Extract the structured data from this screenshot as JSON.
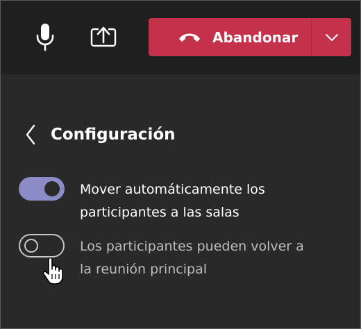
{
  "toolbar": {
    "mic_icon": "microphone-icon",
    "share_icon": "share-screen-icon",
    "leave_label": "Abandonar",
    "leave_icon": "hang-up-icon",
    "leave_dropdown_icon": "chevron-down-icon",
    "leave_color": "#c4314b"
  },
  "panel": {
    "back_icon": "chevron-left-icon",
    "title": "Configuración",
    "options": [
      {
        "label_line1": "Mover automáticamente los",
        "label_line2": "participantes a las salas",
        "checked": true
      },
      {
        "label_line1": "Los participantes pueden volver a",
        "label_line2": "la reunión principal",
        "checked": false
      }
    ]
  },
  "colors": {
    "background": "#292929",
    "toolbar": "#1f1f1f",
    "toggle_on": "#8b8cc7"
  }
}
